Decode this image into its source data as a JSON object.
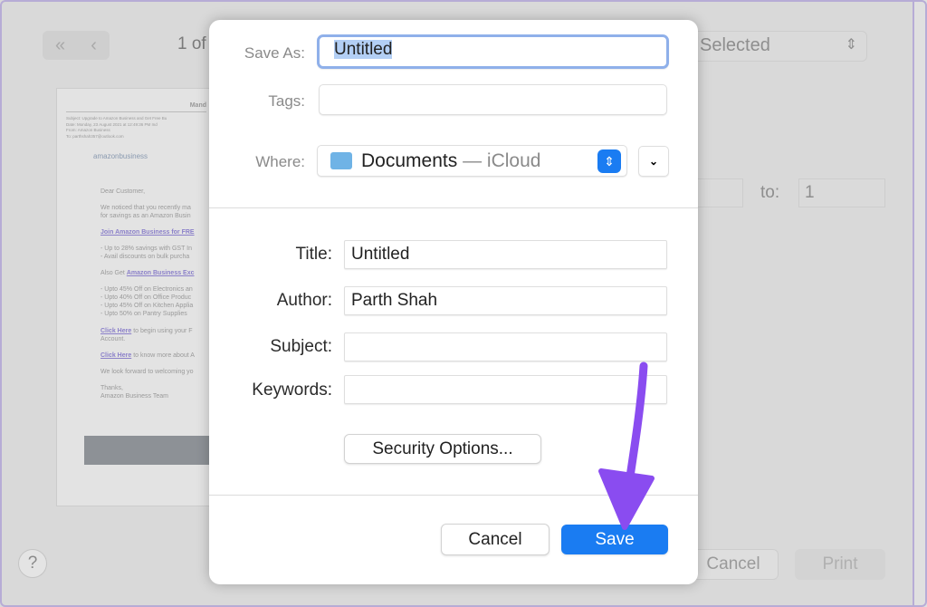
{
  "print_dialog": {
    "page_indicator": "1 of",
    "pages_select": "Selected",
    "to_label": "to:",
    "to_value": "1",
    "cancel_label": "Cancel",
    "print_label": "Print",
    "help_label": "?",
    "nav_icons": [
      "double-chevron-left-icon",
      "chevron-left-icon"
    ],
    "preview": {
      "header": "Mand",
      "meta": [
        "Subject: Upgrade to Amazon Business and Get Free Bu",
        "Date:    Monday, 23 August 2021 at 12:49:36 PM Ind",
        "From:    Amazon Business",
        "To:      parthshah357@outlook.com"
      ],
      "logo": "amazonbusiness",
      "greeting": "Dear Customer,",
      "intro": [
        "We noticed that you recently ma",
        "for savings as an Amazon Busin"
      ],
      "join_link": "Join Amazon Business for FRE",
      "bullets1": [
        "- Up to 28% savings with GST In",
        "- Avail discounts on bulk purcha"
      ],
      "also_get": "Also Get",
      "also_link": "Amazon Business Exc",
      "bullets2": [
        "- Upto 45% Off on Electronics an",
        "- Upto 40% Off on Office Produc",
        "- Upto 45% Off on Kitchen Applia",
        "- Upto 50% on Pantry Supplies"
      ],
      "click_here": "Click Here",
      "click1_rest": "to begin using your F",
      "click1_rest2": "Account.",
      "click2_rest": "to know more about A",
      "closing": "We look forward to welcoming yo",
      "thanks": "Thanks,",
      "team": "Amazon Business Team"
    }
  },
  "save_dialog": {
    "save_as_label": "Save As:",
    "save_as_value": "Untitled",
    "tags_label": "Tags:",
    "tags_value": "",
    "where_label": "Where:",
    "where_value": "Documents",
    "where_location": "— iCloud",
    "title_label": "Title:",
    "title_value": "Untitled",
    "author_label": "Author:",
    "author_value": "Parth Shah",
    "subject_label": "Subject:",
    "subject_value": "",
    "keywords_label": "Keywords:",
    "keywords_value": "",
    "security_button": "Security Options...",
    "cancel_button": "Cancel",
    "save_button": "Save"
  },
  "colors": {
    "accent": "#1a7cf2",
    "annotation_arrow": "#8a4cf0",
    "selection": "#b3cff5"
  }
}
